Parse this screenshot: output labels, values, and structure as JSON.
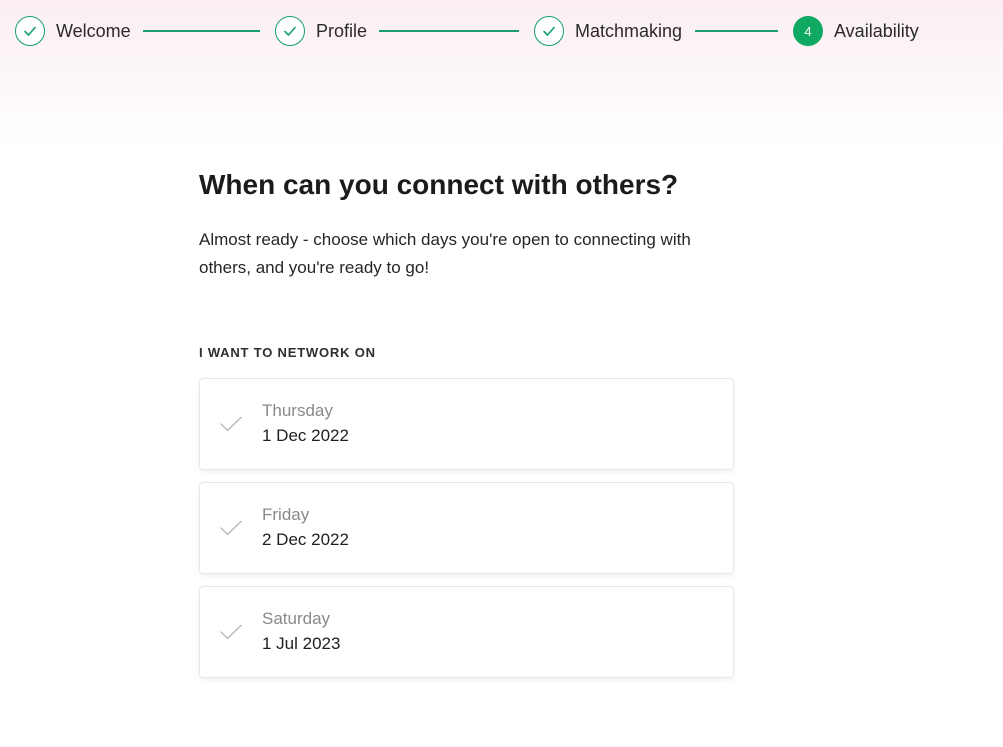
{
  "stepper": {
    "steps": [
      {
        "label": "Welcome",
        "state": "complete"
      },
      {
        "label": "Profile",
        "state": "complete"
      },
      {
        "label": "Matchmaking",
        "state": "complete"
      },
      {
        "label": "Availability",
        "state": "current",
        "number": "4"
      }
    ],
    "accent_color": "#0fa964"
  },
  "main": {
    "title": "When can you connect with others?",
    "intro": "Almost ready - choose which days you're open to connecting with others, and you're ready to go!",
    "section_label": "I WANT TO NETWORK ON",
    "days": [
      {
        "day": "Thursday",
        "date": "1 Dec 2022",
        "selected": false
      },
      {
        "day": "Friday",
        "date": "2 Dec 2022",
        "selected": false
      },
      {
        "day": "Saturday",
        "date": "1 Jul 2023",
        "selected": false
      }
    ]
  }
}
